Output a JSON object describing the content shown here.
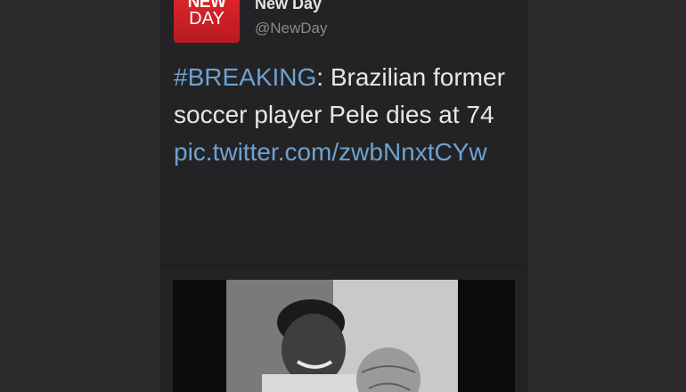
{
  "tweet": {
    "avatar": {
      "line1": "NEW",
      "line2": "DAY"
    },
    "account_name": "New Day",
    "handle": "@NewDay",
    "hashtag": "#BREAKING",
    "text": ": Brazilian former soccer player Pele dies at 74",
    "link": "pic.twitter.com/zwbNnxtCYw"
  },
  "colors": {
    "background": "#2c2c2e",
    "card": "#232325",
    "link": "#6ea1d0",
    "brand_red": "#d8232a"
  }
}
